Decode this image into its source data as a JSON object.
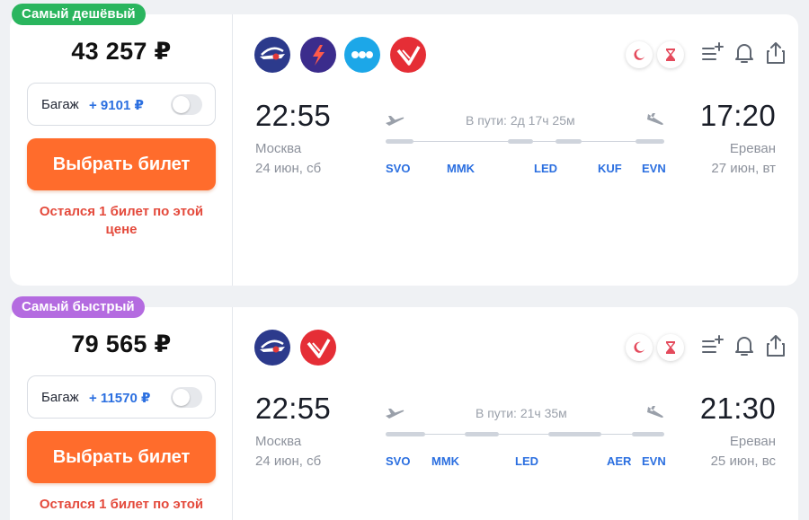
{
  "offers": [
    {
      "badge": "Самый дешёвый",
      "badge_color": "#2ab55e",
      "price": "43 257 ₽",
      "baggage_label": "Багаж",
      "baggage_price": "+ 9101 ₽",
      "buy_label": "Выбрать билет",
      "warning": "Остался 1 билет по этой цене",
      "transit": "В пути: 2д 17ч 25м",
      "departure": {
        "time": "22:55",
        "city": "Москва",
        "date": "24 июн, сб"
      },
      "arrival": {
        "time": "17:20",
        "city": "Ереван",
        "date": "27 июн, вт"
      },
      "airports": [
        "SVO",
        "MMK",
        "LED",
        "KUF",
        "EVN"
      ],
      "airlines": [
        "aeroflot-logo",
        "rossiya-logo",
        "dots-airline-logo",
        "nordwind-logo"
      ]
    },
    {
      "badge": "Самый быстрый",
      "badge_color": "#b46be0",
      "price": "79 565 ₽",
      "baggage_label": "Багаж",
      "baggage_price": "+ 11570 ₽",
      "buy_label": "Выбрать билет",
      "warning": "Остался 1 билет по этой",
      "transit": "В пути: 21ч 35м",
      "departure": {
        "time": "22:55",
        "city": "Москва",
        "date": "24 июн, сб"
      },
      "arrival": {
        "time": "21:30",
        "city": "Ереван",
        "date": "25 июн, вс"
      },
      "airports": [
        "SVO",
        "MMK",
        "LED",
        "AER",
        "EVN"
      ],
      "airlines": [
        "aeroflot-logo",
        "nordwind-logo"
      ]
    }
  ],
  "icons": {
    "night": "moon-icon",
    "long_layover": "hourglass-icon",
    "add_to_list": "add-to-list-icon",
    "subscribe": "bell-icon",
    "share": "share-icon"
  },
  "colors": {
    "accent_orange": "#ff6c2c",
    "link_blue": "#2b6fe0",
    "warning_red": "#e44a3c"
  }
}
